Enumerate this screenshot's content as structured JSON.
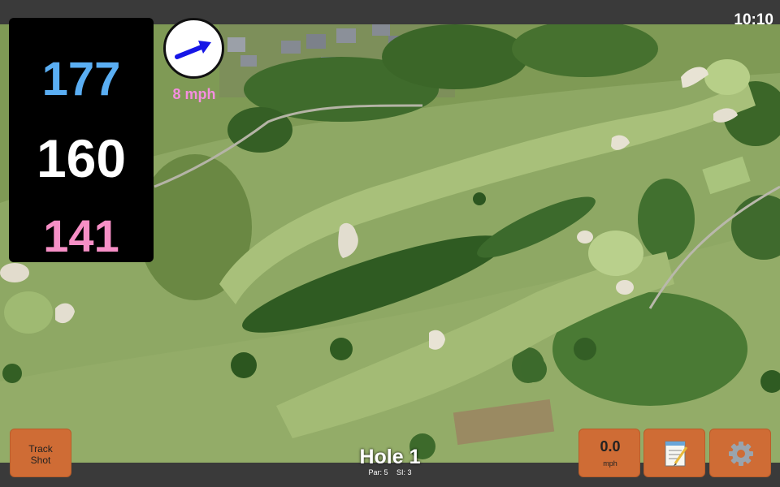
{
  "status": {
    "time": "10:10"
  },
  "yardages": {
    "back": "177",
    "middle": "160",
    "front": "141"
  },
  "wind": {
    "speed_label": "8 mph",
    "direction_icon": "arrow-icon"
  },
  "hole": {
    "title": "Hole 1",
    "par": "Par: 5",
    "stroke_index": "SI: 3"
  },
  "buttons": {
    "track_shot_line1": "Track",
    "track_shot_line2": "Shot",
    "speed_value": "0.0",
    "speed_unit": "mph",
    "notes_icon": "notepad-icon",
    "settings_icon": "gear-icon"
  },
  "colors": {
    "back_yardage": "#5aaef3",
    "middle_yardage": "#ffffff",
    "front_yardage": "#f68fc6",
    "wind_text": "#f58ee0",
    "button_accent": "#cf6c35"
  }
}
